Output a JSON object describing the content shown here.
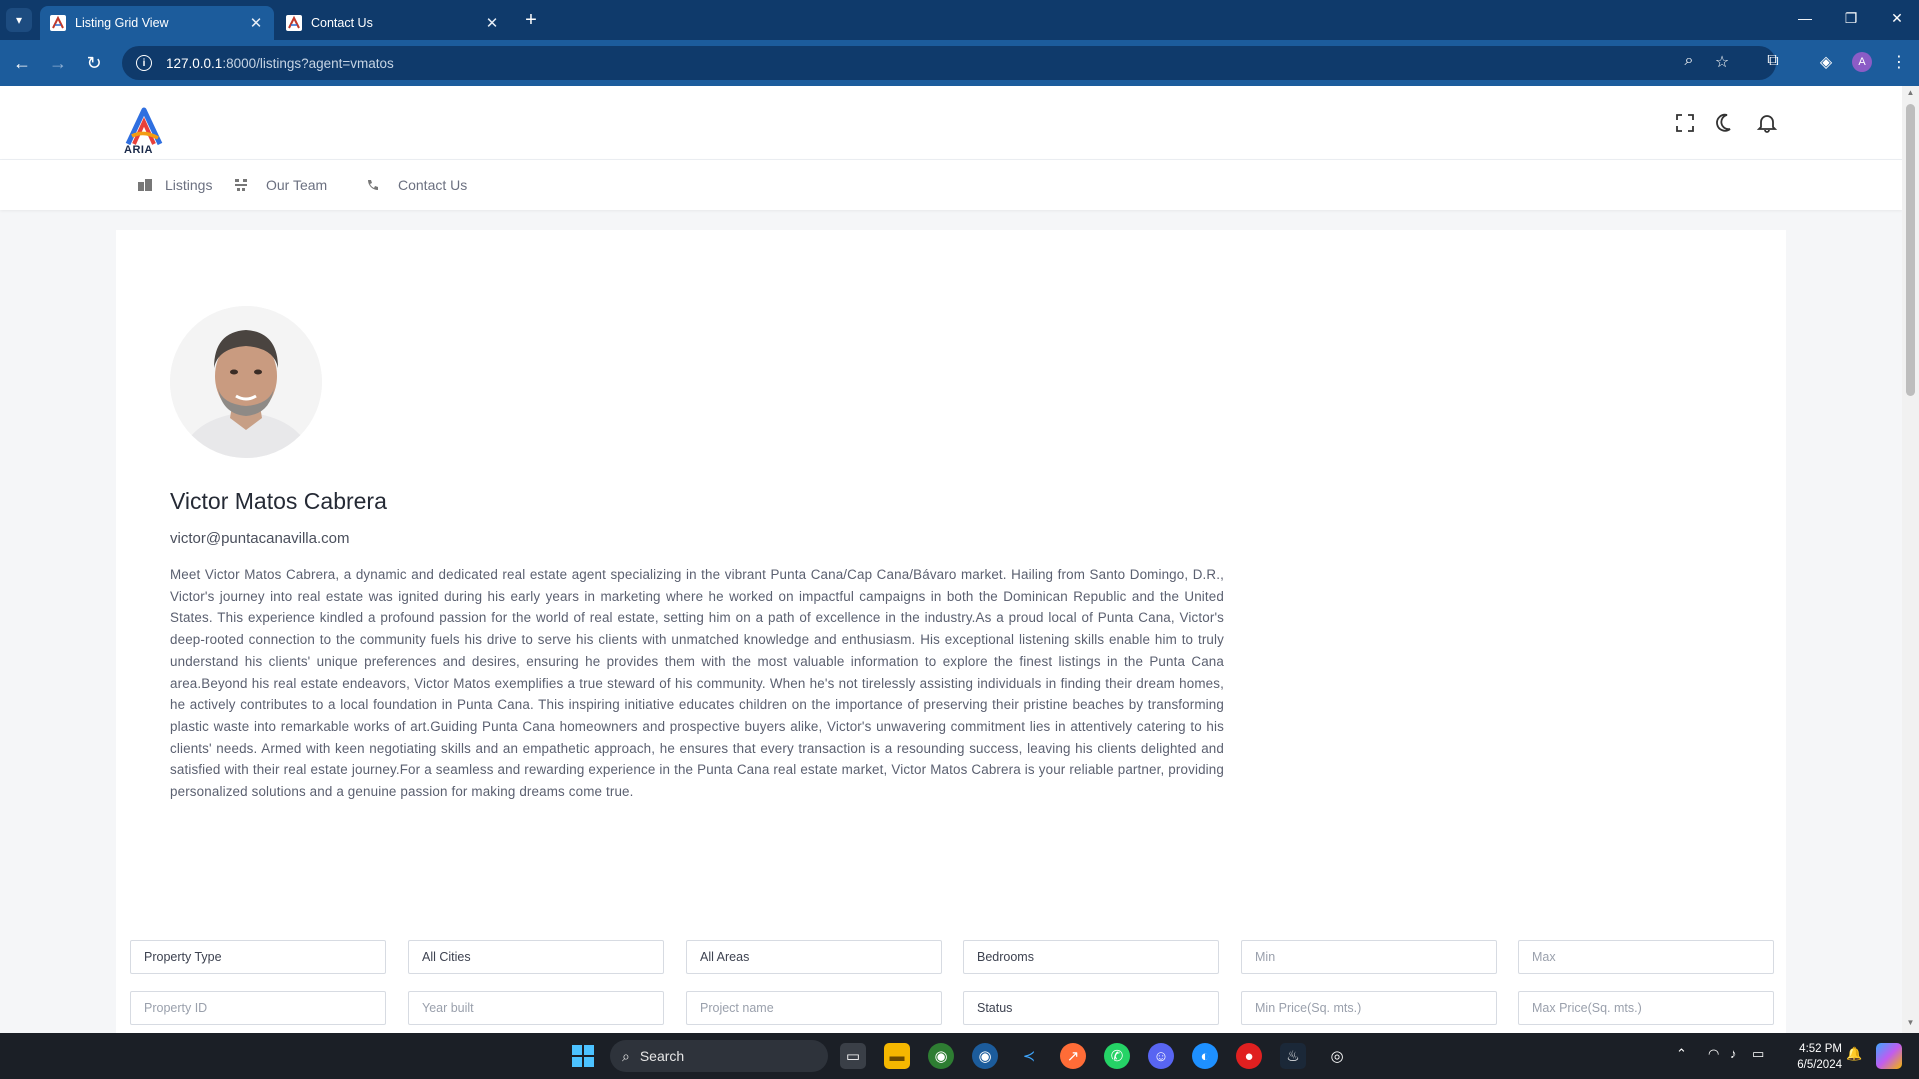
{
  "browser": {
    "tabs": [
      {
        "title": "Listing Grid View",
        "active": true
      },
      {
        "title": "Contact Us",
        "active": false
      }
    ],
    "url_host": "127.0.0.1",
    "url_path": ":8000/listings?agent=vmatos",
    "avatar_letter": "A"
  },
  "site": {
    "logo_text": "ARIA",
    "nav": [
      {
        "label": "Listings",
        "icon": "building-icon"
      },
      {
        "label": "Our Team",
        "icon": "team-icon"
      },
      {
        "label": "Contact Us",
        "icon": "phone-icon"
      }
    ]
  },
  "agent": {
    "name": "Victor Matos Cabrera",
    "email": "victor@puntacanavilla.com",
    "bio": "Meet Victor Matos Cabrera, a dynamic and dedicated real estate agent specializing in the vibrant Punta Cana/Cap Cana/Bávaro market. Hailing from Santo Domingo, D.R., Victor's journey into real estate was ignited during his early years in marketing where he worked on impactful campaigns in both the Dominican Republic and the United States. This experience kindled a profound passion for the world of real estate, setting him on a path of excellence in the industry.As a proud local of Punta Cana, Victor's deep-rooted connection to the community fuels his drive to serve his clients with unmatched knowledge and enthusiasm. His exceptional listening skills enable him to truly understand his clients' unique preferences and desires, ensuring he provides them with the most valuable information to explore the finest listings in the Punta Cana area.Beyond his real estate endeavors, Victor Matos exemplifies a true steward of his community. When he's not tirelessly assisting individuals in finding their dream homes, he actively contributes to a local foundation in Punta Cana. This inspiring initiative educates children on the importance of preserving their pristine beaches by transforming plastic waste into remarkable works of art.Guiding Punta Cana homeowners and prospective buyers alike, Victor's unwavering commitment lies in attentively catering to his clients' needs. Armed with keen negotiating skills and an empathetic approach, he ensures that every transaction is a resounding success, leaving his clients delighted and satisfied with their real estate journey.For a seamless and rewarding experience in the Punta Cana real estate market, Victor Matos Cabrera is your reliable partner, providing personalized solutions and a genuine passion for making dreams come true."
  },
  "filters": {
    "row1": {
      "property_type": "Property Type",
      "cities": "All Cities",
      "areas": "All Areas",
      "bedrooms": "Bedrooms",
      "min_placeholder": "Min",
      "max_placeholder": "Max"
    },
    "row2": {
      "property_id_placeholder": "Property ID",
      "year_built_placeholder": "Year built",
      "project_name_placeholder": "Project name",
      "status": "Status",
      "min_price_placeholder": "Min Price(Sq. mts.)",
      "max_price_placeholder": "Max Price(Sq. mts.)"
    }
  },
  "taskbar": {
    "search_label": "Search",
    "time": "4:52 PM",
    "date": "6/5/2024"
  },
  "colors": {
    "tabbar": "#0f3a6b",
    "toolbar": "#1c5c9c",
    "taskbar": "#1b1f26"
  }
}
